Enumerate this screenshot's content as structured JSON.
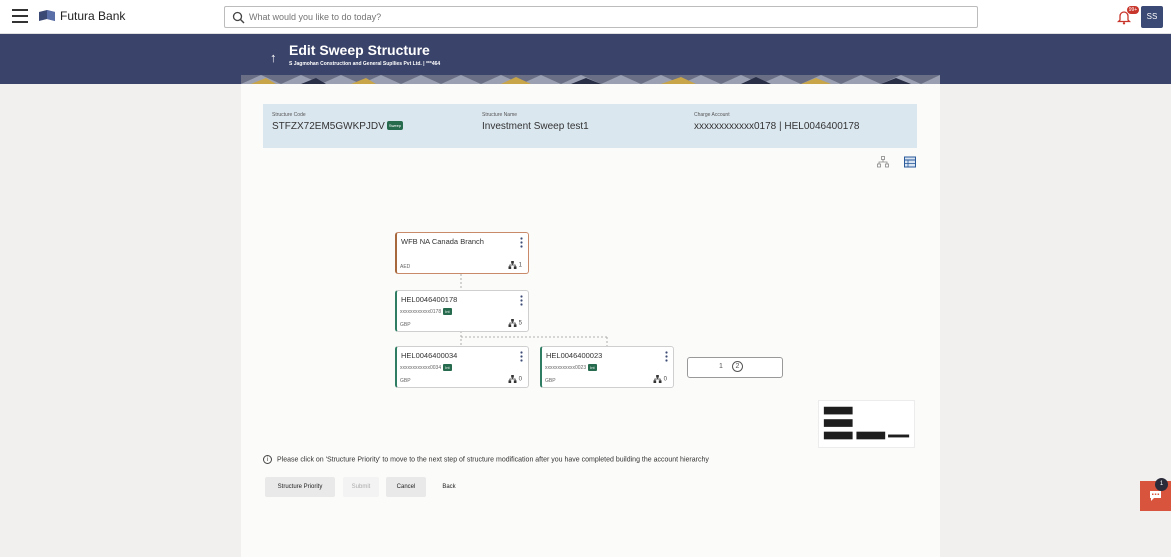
{
  "app": {
    "brand": "Futura Bank"
  },
  "search": {
    "placeholder": "What would you like to do today?"
  },
  "header": {
    "notification_badge": "99+",
    "user_initials": "SS",
    "title": "Edit Sweep Structure",
    "subtitle": "S Jagmohan Construction and General Supllies Pvt Ltd. | ***464"
  },
  "info": {
    "structure_code_label": "Structure Code",
    "structure_code": "STFZX72EM5GWKPJDV",
    "sweep_badge": "Sweep",
    "structure_name_label": "Structure Name",
    "structure_name": "Investment Sweep test1",
    "charge_account_label": "Charge Account",
    "charge_account": "xxxxxxxxxxxx0178 | HEL0046400178"
  },
  "tree": {
    "root": {
      "name": "WFB NA Canada Branch",
      "currency": "AED",
      "children": "1"
    },
    "level1": {
      "name": "HEL0046400178",
      "account": "xxxxxxxxxxxx0178",
      "badge": "Int",
      "currency": "GBP",
      "children": "5"
    },
    "level2": [
      {
        "name": "HEL0046400034",
        "account": "xxxxxxxxxxxx0034",
        "badge": "Int",
        "currency": "GBP",
        "children": "0"
      },
      {
        "name": "HEL0046400023",
        "account": "xxxxxxxxxxxx0023",
        "badge": "Int",
        "currency": "GBP",
        "children": "0"
      }
    ]
  },
  "pagination": {
    "page1": "1",
    "page2": "2"
  },
  "note": "Please click on 'Structure Priority' to move to the next step of structure modification after you have completed building the account hierarchy",
  "buttons": {
    "structure_priority": "Structure Priority",
    "submit": "Submit",
    "cancel": "Cancel",
    "back": "Back"
  },
  "chat": {
    "badge": "1"
  },
  "colors": {
    "header_bg": "#3a4369",
    "info_bg": "#dbe7ef",
    "badge_green": "#276b4f",
    "chat_bg": "#d9543c"
  }
}
